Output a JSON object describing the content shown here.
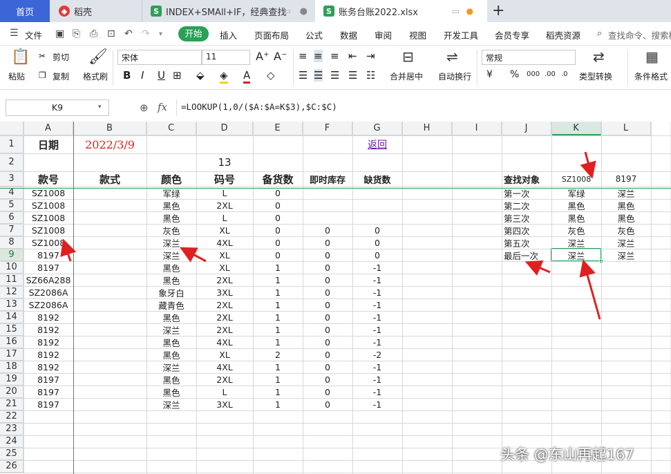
{
  "tabs": {
    "home": "首页",
    "docer": "稻壳",
    "index": "INDEX+SMAll+IF，经典查找",
    "ledger": "账务台账2022.xlsx"
  },
  "menu": [
    "文件",
    "开始",
    "插入",
    "页面布局",
    "公式",
    "数据",
    "审阅",
    "视图",
    "开发工具",
    "会员专享",
    "稻壳资源"
  ],
  "search_placeholder": "查找命令、搜索模",
  "ribbon": {
    "paste": "粘贴",
    "cut": "剪切",
    "copy": "复制",
    "format_painter": "格式刷",
    "font_name": "宋体",
    "font_size": "11",
    "merge": "合并居中",
    "wrap": "自动换行",
    "number_format": "常规",
    "type_convert": "类型转换",
    "cond_format": "条件格式"
  },
  "name_box": "K9",
  "fx": "fx",
  "formula": "=LOOKUP(1,0/($A:$A=K$3),$C:$C)",
  "columns": [
    "A",
    "B",
    "C",
    "D",
    "E",
    "F",
    "G",
    "H",
    "I",
    "J",
    "K",
    "L"
  ],
  "rows": [
    "1",
    "2",
    "3",
    "4",
    "5",
    "6",
    "7",
    "8",
    "9",
    "10",
    "11",
    "12",
    "13",
    "14",
    "15",
    "16",
    "17",
    "18",
    "19",
    "20",
    "21",
    "22",
    "23",
    "24",
    "25",
    "26"
  ],
  "title": {
    "date_label": "日期",
    "date_value": "2022/3/9",
    "return_link": "返回",
    "d2": "13"
  },
  "headers": {
    "a": "款号",
    "b": "款式",
    "c": "颜色",
    "d": "码号",
    "e": "备货数",
    "f": "即时库存",
    "g": "缺货数"
  },
  "data_rows": [
    [
      "SZ1008",
      "军绿",
      "L",
      "0",
      "",
      ""
    ],
    [
      "SZ1008",
      "黑色",
      "2XL",
      "0",
      "",
      ""
    ],
    [
      "SZ1008",
      "黑色",
      "L",
      "0",
      "",
      ""
    ],
    [
      "SZ1008",
      "灰色",
      "XL",
      "0",
      "0",
      "0"
    ],
    [
      "SZ1008",
      "深兰",
      "4XL",
      "0",
      "0",
      "0"
    ],
    [
      "8197",
      "深兰",
      "XL",
      "0",
      "0",
      "0"
    ],
    [
      "8197",
      "黑色",
      "XL",
      "1",
      "0",
      "-1"
    ],
    [
      "SZ66A288",
      "黑色",
      "2XL",
      "1",
      "0",
      "-1"
    ],
    [
      "SZ2086A",
      "象牙白",
      "3XL",
      "1",
      "0",
      "-1"
    ],
    [
      "SZ2086A",
      "藏青色",
      "2XL",
      "1",
      "0",
      "-1"
    ],
    [
      "8192",
      "黑色",
      "2XL",
      "1",
      "0",
      "-1"
    ],
    [
      "8192",
      "深兰",
      "2XL",
      "1",
      "0",
      "-1"
    ],
    [
      "8192",
      "黑色",
      "4XL",
      "1",
      "0",
      "-1"
    ],
    [
      "8192",
      "黑色",
      "XL",
      "2",
      "0",
      "-2"
    ],
    [
      "8192",
      "深兰",
      "4XL",
      "1",
      "0",
      "-1"
    ],
    [
      "8197",
      "黑色",
      "2XL",
      "1",
      "0",
      "-1"
    ],
    [
      "8197",
      "黑色",
      "L",
      "1",
      "0",
      "-1"
    ],
    [
      "8197",
      "深兰",
      "3XL",
      "1",
      "0",
      "-1"
    ]
  ],
  "lookup": {
    "label": "查找对象",
    "k3": "SZ1008",
    "l3": "8197",
    "rows": [
      [
        "第一次",
        "军绿",
        "深兰"
      ],
      [
        "第二次",
        "黑色",
        "黑色"
      ],
      [
        "第三次",
        "黑色",
        "黑色"
      ],
      [
        "第四次",
        "灰色",
        "灰色"
      ],
      [
        "第五次",
        "深兰",
        "深兰"
      ],
      [
        "最后一次",
        "深兰",
        "深兰"
      ]
    ]
  },
  "watermark": "头条 @东山再起167",
  "colors": {
    "accent": "#2aa157",
    "tab_blue": "#3c66d8",
    "date_red": "#e02020",
    "arrow_red": "#e02020",
    "selection": "#1f9d55"
  }
}
